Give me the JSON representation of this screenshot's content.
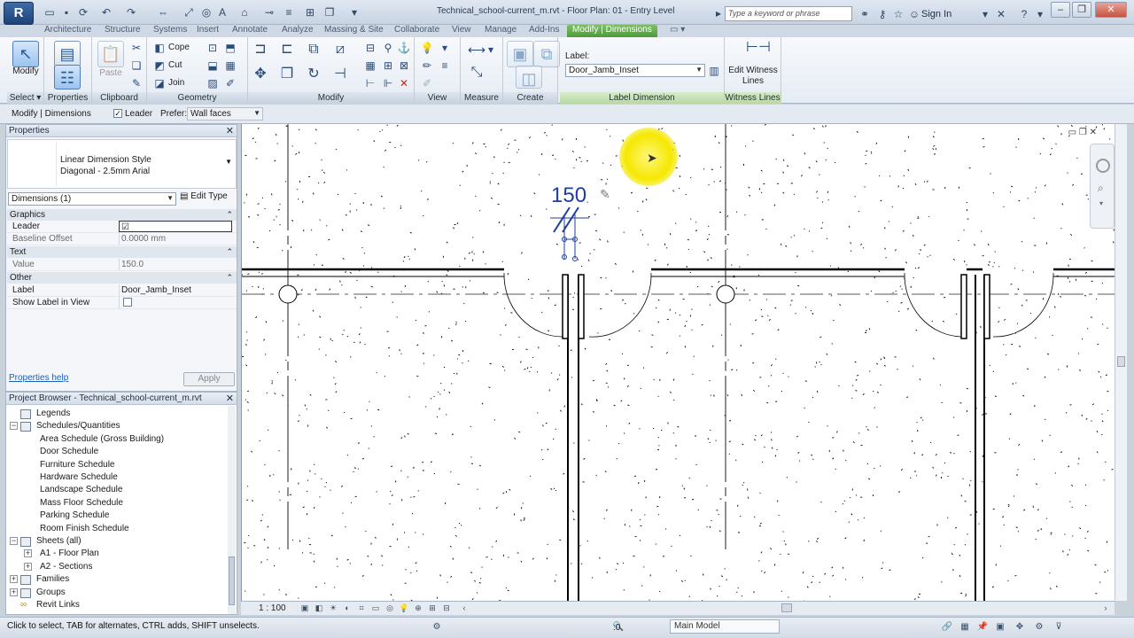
{
  "app": {
    "button_label": "R",
    "document_title": "Technical_school-current_m.rvt - Floor Plan: 01 - Entry Level",
    "search_placeholder": "Type a keyword or phrase",
    "signin": "Sign In"
  },
  "ribbon_tabs": [
    "Architecture",
    "Structure",
    "Systems",
    "Insert",
    "Annotate",
    "Analyze",
    "Massing & Site",
    "Collaborate",
    "View",
    "Manage",
    "Add-Ins",
    "Modify | Dimensions"
  ],
  "ribbon": {
    "select": {
      "button": "Modify",
      "label": "Select ▾"
    },
    "properties": {
      "label": "Properties"
    },
    "clipboard": {
      "paste": "Paste",
      "label": "Clipboard"
    },
    "geometry": {
      "cope": "Cope",
      "cut": "Cut",
      "join": "Join",
      "label": "Geometry"
    },
    "modify": {
      "label": "Modify"
    },
    "view": {
      "label": "View"
    },
    "measure": {
      "label": "Measure"
    },
    "create": {
      "label": "Create"
    },
    "label_dimension": {
      "field_label": "Label:",
      "value": "Door_Jamb_Inset",
      "panel_label": "Label Dimension"
    },
    "witness_lines": {
      "button": "Edit Witness Lines",
      "panel_label": "Witness Lines"
    }
  },
  "options_bar": {
    "context": "Modify | Dimensions",
    "leader_label": "Leader",
    "leader_checked": true,
    "prefer_label": "Prefer:",
    "prefer_value": "Wall faces"
  },
  "properties": {
    "title": "Properties",
    "type_name_1": "Linear Dimension Style",
    "type_name_2": "Diagonal - 2.5mm Arial",
    "instance_filter": "Dimensions (1)",
    "edit_type": "Edit Type",
    "groups": {
      "graphics": "Graphics",
      "text": "Text",
      "other": "Other"
    },
    "rows": {
      "leader": {
        "key": "Leader",
        "value": "☑"
      },
      "baseline": {
        "key": "Baseline Offset",
        "value": "0.0000 mm"
      },
      "value": {
        "key": "Value",
        "value": "150.0"
      },
      "label": {
        "key": "Label",
        "value": "Door_Jamb_Inset"
      },
      "show_label": {
        "key": "Show Label in View",
        "value": ""
      }
    },
    "help": "Properties help",
    "apply": "Apply"
  },
  "project_browser": {
    "title": "Project Browser - Technical_school-current_m.rvt",
    "items": [
      {
        "label": "Legends",
        "level": 0,
        "expander": ""
      },
      {
        "label": "Schedules/Quantities",
        "level": 0,
        "expander": "−"
      },
      {
        "label": "Area Schedule (Gross Building)",
        "level": 1,
        "expander": ""
      },
      {
        "label": "Door Schedule",
        "level": 1,
        "expander": ""
      },
      {
        "label": "Furniture Schedule",
        "level": 1,
        "expander": ""
      },
      {
        "label": "Hardware Schedule",
        "level": 1,
        "expander": ""
      },
      {
        "label": "Landscape Schedule",
        "level": 1,
        "expander": ""
      },
      {
        "label": "Mass Floor Schedule",
        "level": 1,
        "expander": ""
      },
      {
        "label": "Parking Schedule",
        "level": 1,
        "expander": ""
      },
      {
        "label": "Room Finish Schedule",
        "level": 1,
        "expander": ""
      },
      {
        "label": "Sheets (all)",
        "level": 0,
        "expander": "−"
      },
      {
        "label": "A1 - Floor Plan",
        "level": 1,
        "expander": "+"
      },
      {
        "label": "A2 - Sections",
        "level": 1,
        "expander": "+"
      },
      {
        "label": "Families",
        "level": 0,
        "expander": "+"
      },
      {
        "label": "Groups",
        "level": 0,
        "expander": "+"
      },
      {
        "label": "Revit Links",
        "level": 0,
        "expander": ""
      }
    ]
  },
  "canvas": {
    "dimension_text": "150"
  },
  "view_bar": {
    "scale": "1 : 100"
  },
  "status_bar": {
    "message": "Click to select, TAB for alternates, CTRL adds, SHIFT unselects.",
    "selection_count": ":0",
    "model": "Main Model"
  }
}
